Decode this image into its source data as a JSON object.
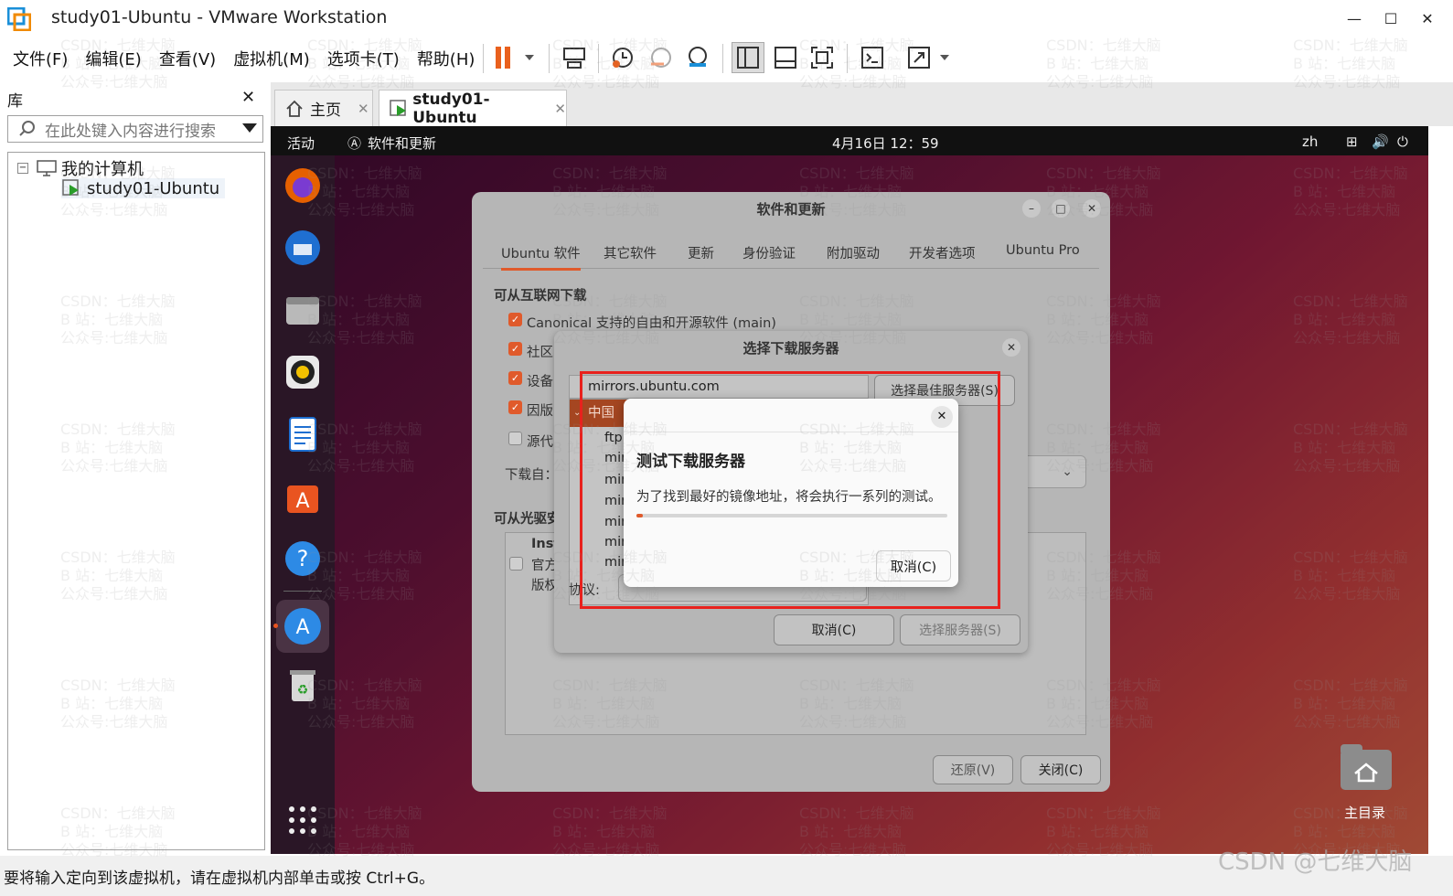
{
  "window": {
    "title": "study01-Ubuntu - VMware Workstation"
  },
  "menu": [
    "文件(F)",
    "编辑(E)",
    "查看(V)",
    "虚拟机(M)",
    "选项卡(T)",
    "帮助(H)"
  ],
  "library": {
    "title": "库",
    "search_placeholder": "在此处键入内容进行搜索",
    "tree_root": "我的计算机",
    "tree_vm": "study01-Ubuntu"
  },
  "tabs": {
    "home": "主页",
    "vm": "study01-Ubuntu"
  },
  "gnome": {
    "activities": "活动",
    "app": "软件和更新",
    "clock": "4月16日 12：59",
    "lang": "zh"
  },
  "desktop": {
    "home_label": "主目录"
  },
  "sw_dialog": {
    "title": "软件和更新",
    "tabs": [
      "Ubuntu 软件",
      "其它软件",
      "更新",
      "身份验证",
      "附加驱动",
      "开发者选项",
      "Ubuntu Pro"
    ],
    "section_internet": "可从互联网下载",
    "checks": [
      "Canonical 支持的自由和开源软件 (main)",
      "社区",
      "设备",
      "因版",
      "源代"
    ],
    "download_from": "下载自：",
    "section_cdrom": "可从光驱安",
    "cd_lines": [
      "Inst",
      "官方",
      "版权"
    ],
    "revert": "还原(V)",
    "close": "关闭(C)"
  },
  "server_dialog": {
    "title": "选择下载服务器",
    "current": "mirrors.ubuntu.com",
    "best_btn": "选择最佳服务器(S)",
    "country": "中国",
    "list": [
      "ftp",
      "mir",
      "mir",
      "mir",
      "mir",
      "mir",
      "mir"
    ],
    "protocol": "协议:",
    "cancel": "取消(C)",
    "choose": "选择服务器(S)"
  },
  "test_dialog": {
    "title": "测试下载服务器",
    "message": "为了找到最好的镜像地址，将会执行一系列的测试。",
    "progress": 0.02,
    "cancel": "取消(C)"
  },
  "status": "要将输入定向到该虚拟机，请在虚拟机内部单击或按 Ctrl+G。",
  "watermark": "CSDN：七维大脑\nB 站：七维大脑\n公众号:七维大脑",
  "corner_mark": "CSDN @七维大脑",
  "colors": {
    "accent": "#e05a2b",
    "highlight_box": "#e8211d"
  }
}
